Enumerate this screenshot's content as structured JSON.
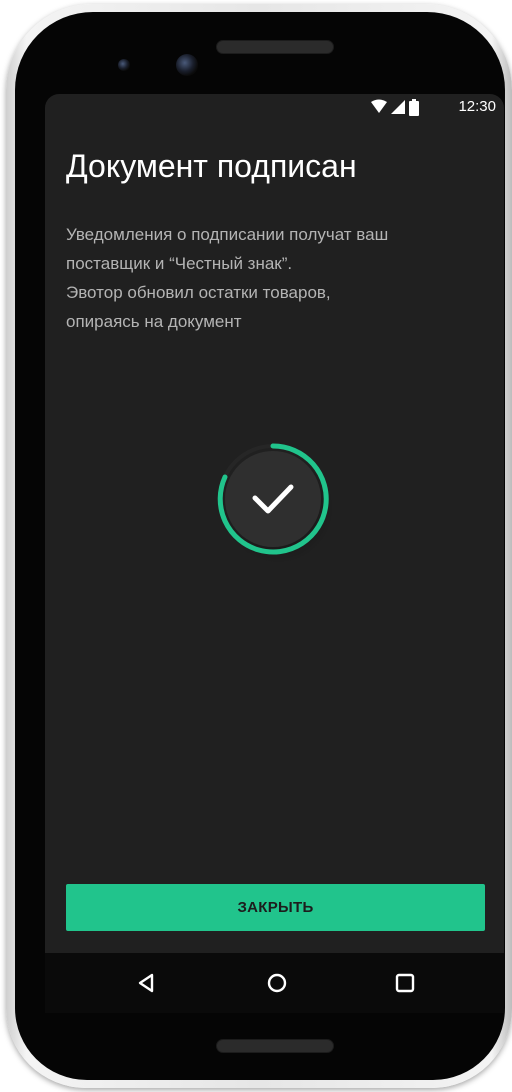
{
  "status_bar": {
    "time": "12:30",
    "icons": [
      "wifi-icon",
      "signal-icon",
      "battery-icon"
    ]
  },
  "screen": {
    "title": "Документ подписан",
    "description_lines": [
      "Уведомления о подписании получат ваш",
      "поставщик и “Честный знак”.",
      "Эвотор обновил остатки товаров,",
      "опираясь на документ"
    ],
    "success_icon": "check-circle-icon",
    "close_button_label": "ЗАКРЫТЬ"
  },
  "nav_bar": {
    "icons": [
      "back-triangle-icon",
      "home-circle-icon",
      "recents-square-icon"
    ]
  },
  "colors": {
    "background": "#202020",
    "accent": "#21c48c",
    "title_text": "#ffffff",
    "body_text": "#b4b4b4"
  }
}
